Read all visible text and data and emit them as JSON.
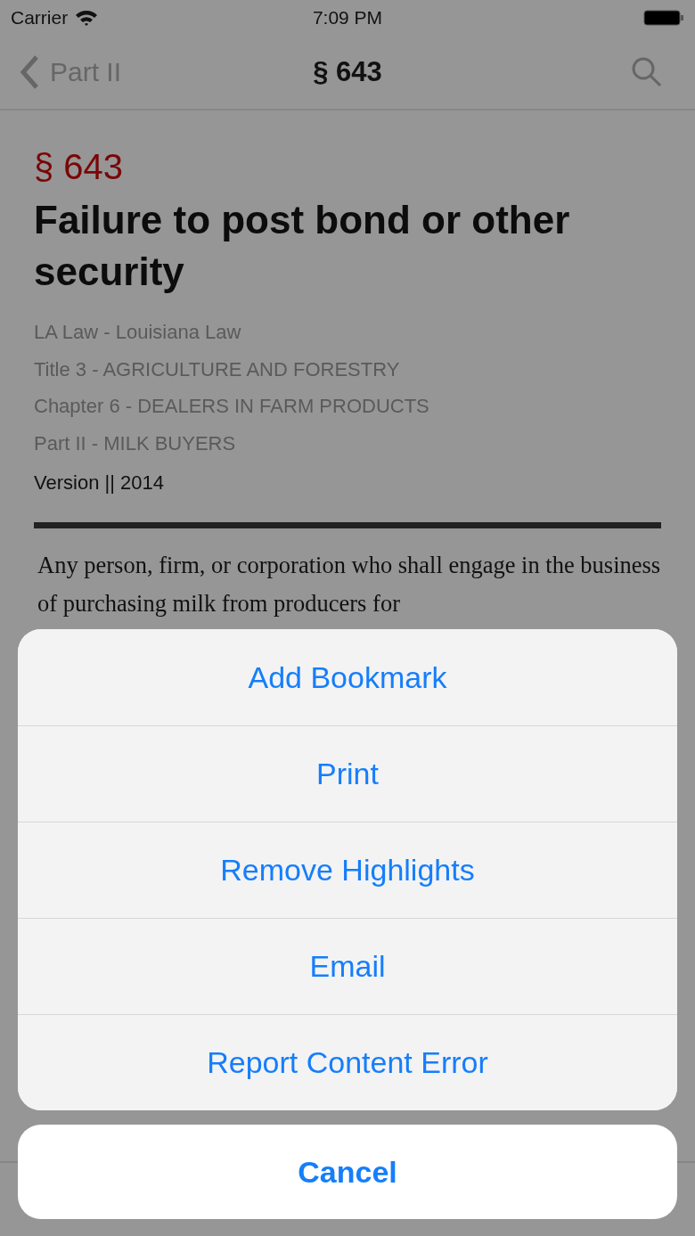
{
  "status_bar": {
    "carrier": "Carrier",
    "time": "7:09 PM"
  },
  "nav": {
    "back_label": "Part II",
    "title": "§ 643"
  },
  "section": {
    "number": "§ 643",
    "title": "Failure to post bond or other security",
    "breadcrumbs": [
      "LA Law - Louisiana Law",
      "Title 3 - AGRICULTURE AND FORESTRY",
      "Chapter 6 - DEALERS IN FARM PRODUCTS",
      "Part II - MILK BUYERS"
    ],
    "version": "Version || 2014",
    "body": "Any person, firm, or corporation who shall engage in the business of purchasing milk from producers for"
  },
  "action_sheet": {
    "actions": [
      "Add Bookmark",
      "Print",
      "Remove Highlights",
      "Email",
      "Report Content Error"
    ],
    "cancel": "Cancel"
  }
}
